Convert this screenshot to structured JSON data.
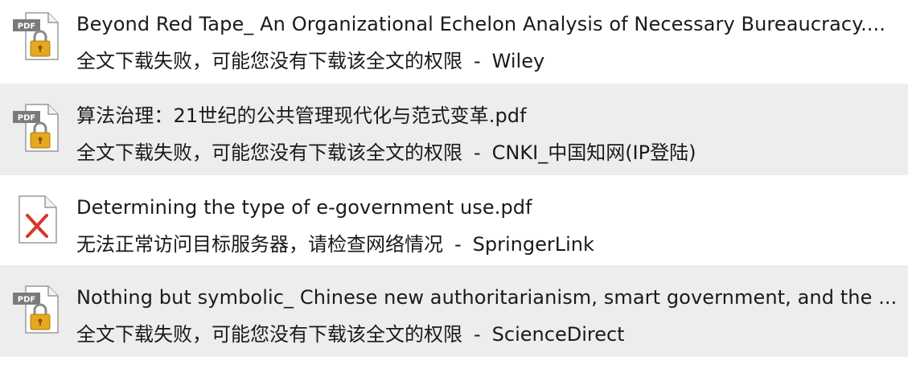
{
  "results": [
    {
      "title": "Beyond Red Tape_ An Organizational Echelon Analysis of Necessary Bureaucracy....",
      "status": "全文下载失败，可能您没有下载该全文的权限",
      "separator": "-",
      "source": "Wiley",
      "icon": "locked-pdf-icon"
    },
    {
      "title": "算法治理：21世纪的公共管理现代化与范式变革.pdf",
      "status": "全文下载失败，可能您没有下载该全文的权限",
      "separator": "-",
      "source": "CNKI_中国知网(IP登陆)",
      "icon": "locked-pdf-icon"
    },
    {
      "title": "Determining the type of e-government use.pdf",
      "status": "无法正常访问目标服务器，请检查网络情况",
      "separator": "-",
      "source": "SpringerLink",
      "icon": "error-file-icon"
    },
    {
      "title": "Nothing but symbolic_ Chinese new authoritarianism, smart government, and the ...",
      "status": "全文下载失败，可能您没有下载该全文的权限",
      "separator": "-",
      "source": "ScienceDirect",
      "icon": "locked-pdf-icon"
    }
  ],
  "icon_labels": {
    "pdf_badge": "PDF"
  },
  "colors": {
    "row_alt_bg": "#ededed",
    "lock_gold": "#e0a51c",
    "error_red": "#d9342b"
  }
}
